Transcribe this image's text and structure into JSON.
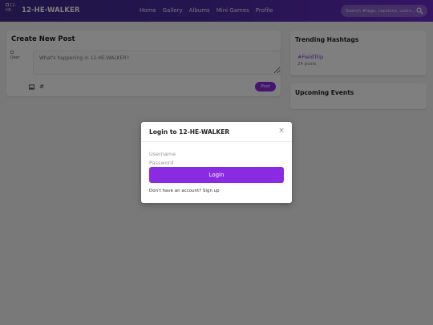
{
  "header": {
    "logo_alt": "12-HE-",
    "brand": "12-HE-WALKER",
    "nav": [
      "Home",
      "Gallery",
      "Albums",
      "Mini Games",
      "Profile"
    ],
    "search_placeholder": "Search #tags, captions, users..."
  },
  "create_post": {
    "title": "Create New Post",
    "avatar_alt": "User",
    "placeholder": "What's happening in 12-HE-WALKER?",
    "tools": [
      "image-icon",
      "hashtag-icon"
    ],
    "post_label": "Post"
  },
  "trending": {
    "title": "Trending Hashtags",
    "tags": [
      {
        "tag": "#FieldTrip",
        "count": "24 posts"
      }
    ]
  },
  "events": {
    "title": "Upcoming Events"
  },
  "modal": {
    "title": "Login to 12-HE-WALKER",
    "close": "×",
    "username_placeholder": "Username",
    "password_placeholder": "Password",
    "login_label": "Login",
    "signup_text": "Don't have an account? Sign up"
  },
  "colors": {
    "accent": "#8a2be2",
    "header_start": "#3f2a8c",
    "header_end": "#6a2ac8"
  }
}
